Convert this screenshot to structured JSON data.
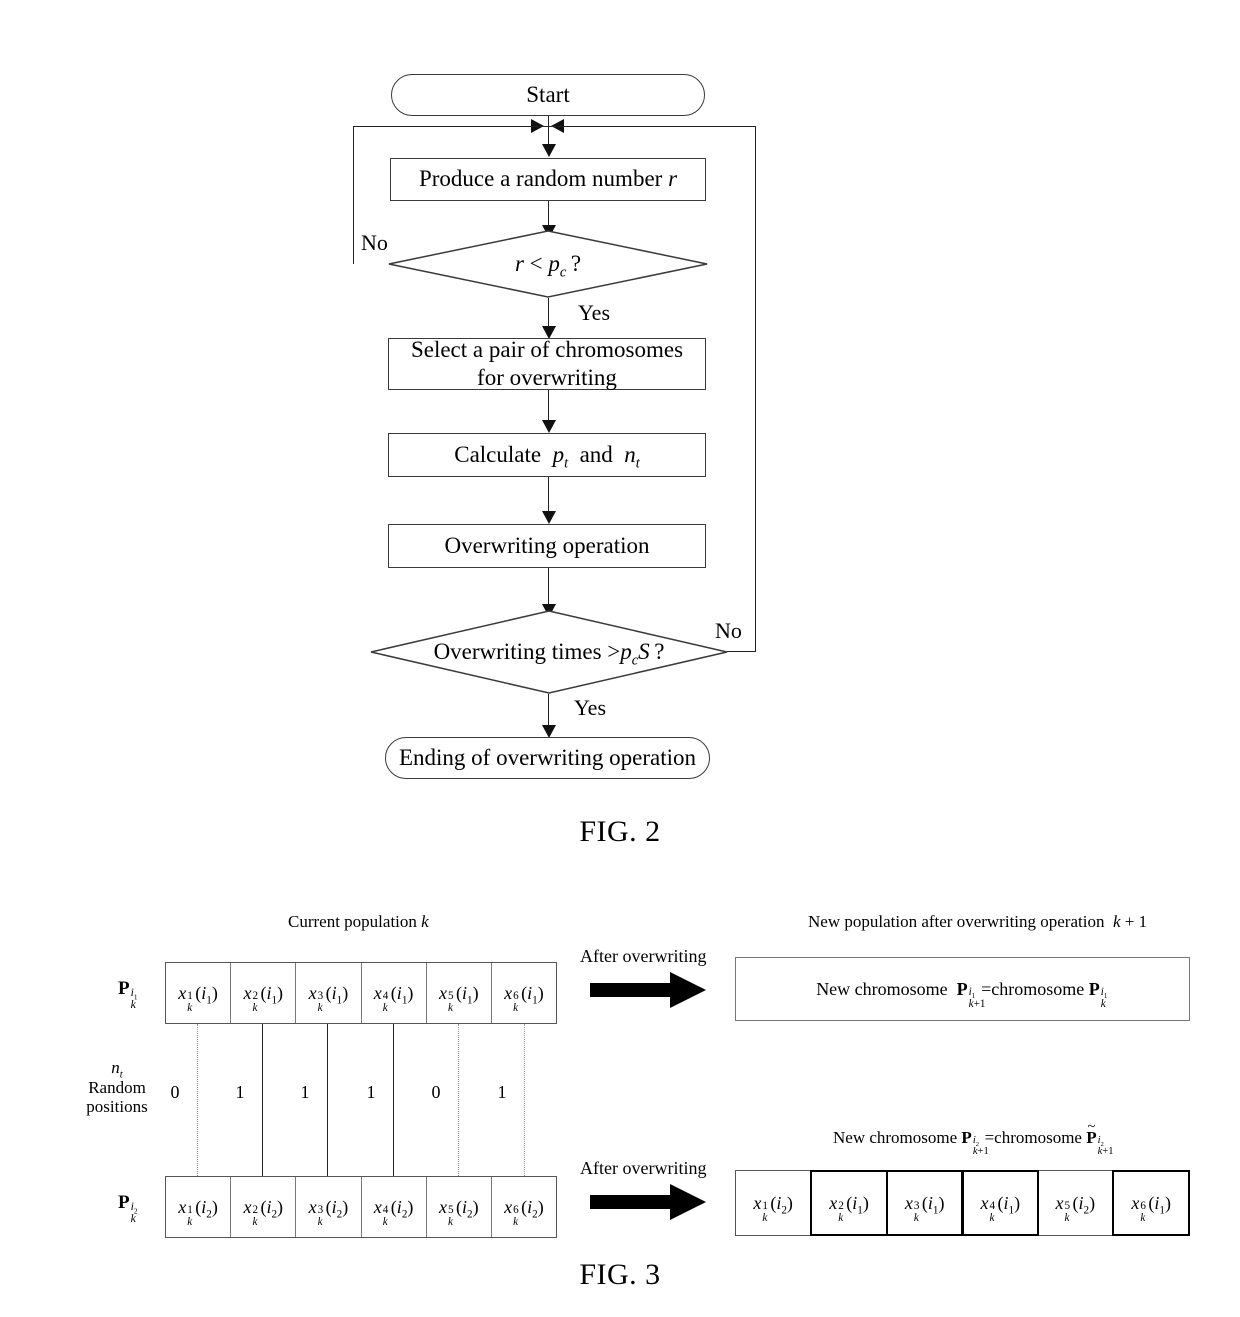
{
  "figure2": {
    "caption": "FIG. 2",
    "nodes": {
      "start": "Start",
      "produce": "Produce a random number r",
      "decision1": "r < p_c ?",
      "select_line1": "Select a pair of chromosomes",
      "select_line2": "for overwriting",
      "calculate": "Calculate p_t and n_t",
      "overwrite": "Overwriting operation",
      "decision2": "Overwriting times > p_c S ?",
      "end": "Ending of overwriting operation"
    },
    "edges": {
      "no1": "No",
      "yes1": "Yes",
      "no2": "No",
      "yes2": "Yes"
    }
  },
  "figure3": {
    "caption": "FIG. 3",
    "titles": {
      "current_population": "Current population k",
      "new_population": "New population after overwriting operation  k + 1",
      "new_chromosome_bottom": "New chromosome P(k+1,i2) = chromosome P~(k+1,i2)"
    },
    "arrow_labels": {
      "top": "After overwriting",
      "bottom": "After overwriting"
    },
    "row_labels": {
      "top": "P_k^{i1}",
      "bottom": "P_k^{i2}"
    },
    "random_positions_label_line1": "n_t",
    "random_positions_label_line2": "Random",
    "random_positions_label_line3": "positions",
    "random_positions": [
      "0",
      "1",
      "1",
      "1",
      "0",
      "1"
    ],
    "top_row_cells": [
      "x_k^1(i_1)",
      "x_k^2(i_1)",
      "x_k^3(i_1)",
      "x_k^4(i_1)",
      "x_k^5(i_1)",
      "x_k^6(i_1)"
    ],
    "bottom_row_cells": [
      "x_k^1(i_2)",
      "x_k^2(i_2)",
      "x_k^3(i_2)",
      "x_k^4(i_2)",
      "x_k^5(i_2)",
      "x_k^6(i_2)"
    ],
    "result_row_cells": [
      "x_k^1(i_2)",
      "x_k^2(i_1)",
      "x_k^3(i_1)",
      "x_k^4(i_1)",
      "x_k^5(i_2)",
      "x_k^6(i_1)"
    ],
    "result_row_bold": [
      false,
      true,
      true,
      true,
      false,
      true
    ],
    "new_chromosome_top": "New chromosome  P_(k+1)^{i1} = chromosome P_k^{i1}"
  },
  "colors": {
    "ink": "#000000",
    "line": "#3a3a3a",
    "background": "#ffffff"
  }
}
